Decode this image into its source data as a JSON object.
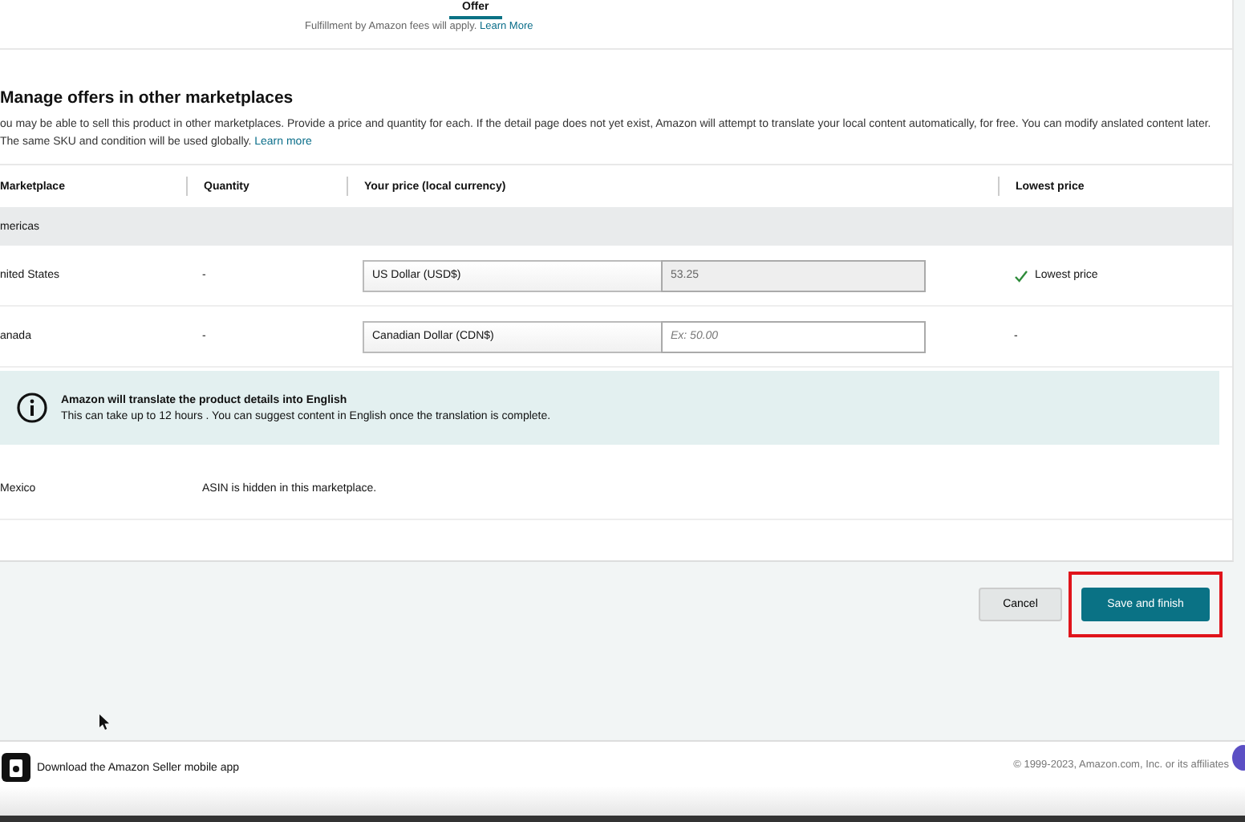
{
  "top_tab": {
    "label": "Offer",
    "selected": true
  },
  "fulfillment_note": {
    "text": "Fulfillment by Amazon fees will apply.",
    "link": "Learn More"
  },
  "section": {
    "title": "Manage offers in other marketplaces",
    "description": "ou may be able to sell this product in other marketplaces. Provide a price and quantity for each. If the detail page does not yet exist, Amazon will attempt to translate your local content automatically, for free. You can modify anslated content later. The same SKU and condition will be used globally.",
    "link": "Learn more"
  },
  "table": {
    "columns": [
      "Marketplace",
      "Quantity",
      "Your price (local currency)",
      "Lowest price"
    ],
    "group": "mericas",
    "rows": [
      {
        "kind": "price",
        "marketplace": "nited States",
        "quantity": "-",
        "currency": "US Dollar (USD$)",
        "price": "53.25",
        "disabled": true,
        "lowest": "Lowest price",
        "is_lowest": true
      },
      {
        "kind": "price",
        "marketplace": "anada",
        "quantity": "-",
        "currency": "Canadian Dollar (CDN$)",
        "placeholder": "Ex: 50.00",
        "disabled": false,
        "lowest": "-",
        "is_lowest": false
      },
      {
        "kind": "notice",
        "title": "Amazon will translate the product details into English",
        "body": "This can take up to 12 hours . You can suggest content in English once the translation is complete."
      },
      {
        "kind": "hidden",
        "marketplace": "Mexico",
        "message": "ASIN is hidden in this marketplace."
      }
    ]
  },
  "buttons": {
    "cancel": "Cancel",
    "save": "Save and finish",
    "save_highlighted": true
  },
  "footer": {
    "app_link": "Download the Amazon Seller mobile app",
    "copyright": "© 1999-2023, Amazon.com, Inc. or its affiliates"
  }
}
